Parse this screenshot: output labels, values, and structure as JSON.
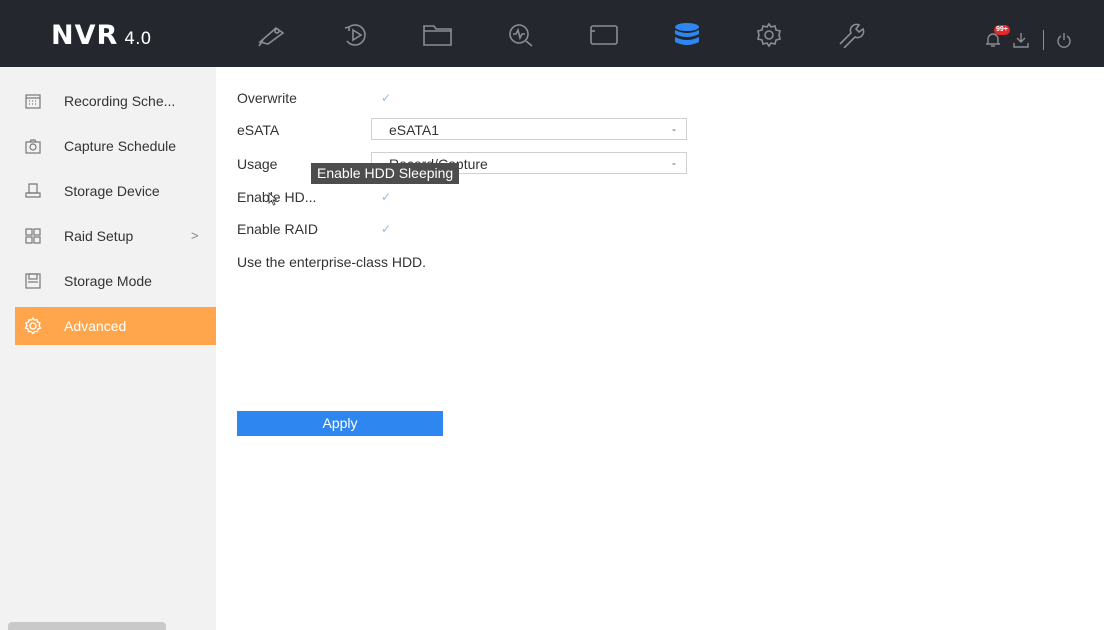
{
  "brand": {
    "name": "NVR",
    "version": "4.0"
  },
  "topnav": [
    {
      "icon": "camera-icon",
      "active": false
    },
    {
      "icon": "playback-icon",
      "active": false
    },
    {
      "icon": "folder-icon",
      "active": false
    },
    {
      "icon": "search-icon",
      "active": false
    },
    {
      "icon": "screen-icon",
      "active": false
    },
    {
      "icon": "storage-icon",
      "active": true
    },
    {
      "icon": "gear-icon",
      "active": false
    },
    {
      "icon": "wrench-icon",
      "active": false
    }
  ],
  "topright": {
    "alarm_badge": "99+",
    "alarm_icon": "alarm-icon",
    "download_icon": "download-icon",
    "power_icon": "power-icon"
  },
  "sidebar": {
    "items": [
      {
        "label": "Recording Sche...",
        "icon": "calendar-icon"
      },
      {
        "label": "Capture Schedule",
        "icon": "snapshot-icon"
      },
      {
        "label": "Storage Device",
        "icon": "hdd-icon"
      },
      {
        "label": "Raid Setup",
        "icon": "raid-icon",
        "chevron": ">"
      },
      {
        "label": "Storage Mode",
        "icon": "storage-mode-icon"
      },
      {
        "label": "Advanced",
        "icon": "advanced-gear-icon",
        "active": true
      }
    ]
  },
  "form": {
    "overwrite_label": "Overwrite",
    "esata_label": "eSATA",
    "esata_value": "eSATA1",
    "usage_label": "Usage",
    "usage_value": "Record/Capture",
    "hdd_sleep_label": "Enable HD...",
    "raid_label": "Enable RAID",
    "note": "Use the enterprise-class HDD.",
    "check_mark": "✓",
    "dropdown_arrow": "-"
  },
  "apply_label": "Apply",
  "tooltip": "Enable HDD Sleeping",
  "colors": {
    "topbar": "#24272e",
    "active_nav": "#2e86f0",
    "sidebar_active": "#ffa64d",
    "apply": "#2e86f0"
  }
}
